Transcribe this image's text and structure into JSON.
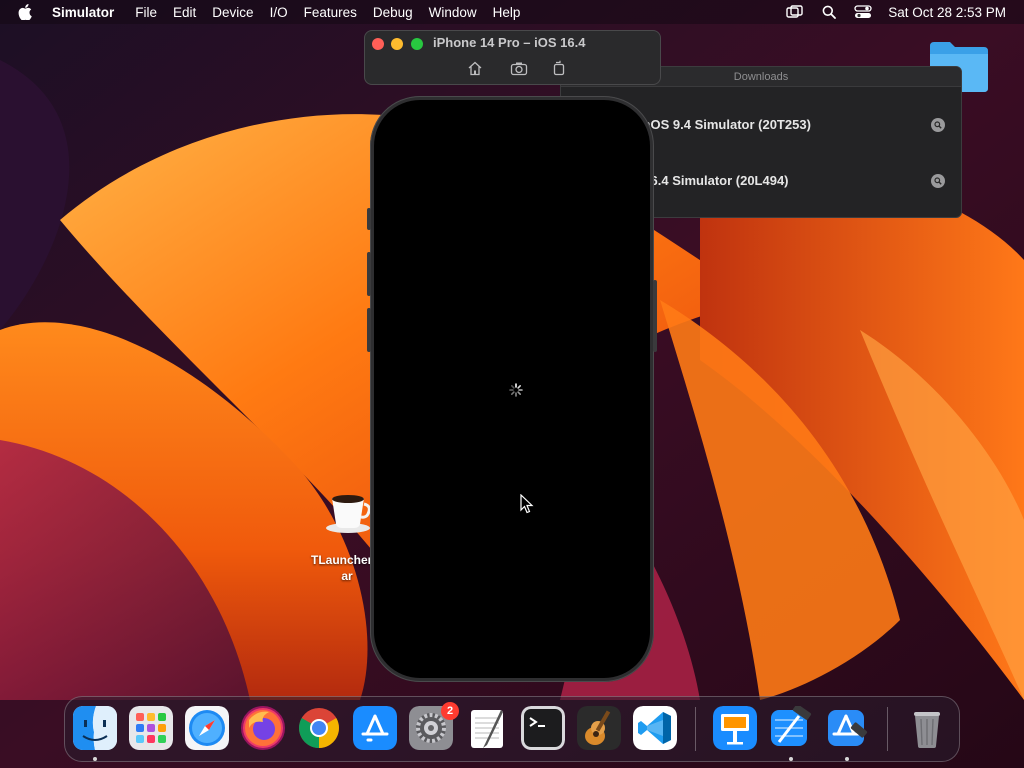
{
  "menubar": {
    "app_name": "Simulator",
    "items": [
      "File",
      "Edit",
      "Device",
      "I/O",
      "Features",
      "Debug",
      "Window",
      "Help"
    ],
    "clock": "Sat Oct 28  2:53 PM",
    "status_icons": [
      "screen-mirroring-icon",
      "search-icon",
      "control-center-icon"
    ]
  },
  "simulator_window": {
    "title": "iPhone 14 Pro – iOS 16.4",
    "toolbar_buttons": [
      "home-icon",
      "screenshot-icon",
      "rotate-icon"
    ]
  },
  "downloads_window": {
    "title": "Downloads",
    "items": [
      {
        "name": "watchOS 9.4 Simulator (20T253)",
        "visible_text": "tchOS 9.4 Simulator (20T253)"
      },
      {
        "name": "iOS 16.4 Simulator (20L494)",
        "visible_text": "S 16.4 Simulator (20L494)"
      }
    ]
  },
  "desktop": {
    "tlauncher_label_line1": "TLauncher-2",
    "tlauncher_label_line2": "ar"
  },
  "dock": {
    "apps": [
      {
        "name": "Finder",
        "icon": "finder-icon",
        "running": true
      },
      {
        "name": "Launchpad",
        "icon": "launchpad-icon",
        "running": false
      },
      {
        "name": "Safari",
        "icon": "safari-icon",
        "running": false
      },
      {
        "name": "Firefox",
        "icon": "firefox-icon",
        "running": false
      },
      {
        "name": "Google Chrome",
        "icon": "chrome-icon",
        "running": false
      },
      {
        "name": "App Store",
        "icon": "app-store-icon",
        "running": false
      },
      {
        "name": "System Settings",
        "icon": "system-settings-icon",
        "running": false,
        "badge": "2"
      },
      {
        "name": "TextEdit",
        "icon": "textedit-icon",
        "running": false
      },
      {
        "name": "Terminal",
        "icon": "terminal-icon",
        "running": false
      },
      {
        "name": "GarageBand",
        "icon": "garageband-icon",
        "running": false
      },
      {
        "name": "Visual Studio Code",
        "icon": "vscode-icon",
        "running": false
      },
      {
        "name": "Keynote",
        "icon": "keynote-icon",
        "running": false
      },
      {
        "name": "Xcode",
        "icon": "xcode-icon",
        "running": true
      },
      {
        "name": "Simulator",
        "icon": "simulator-icon",
        "running": true
      },
      {
        "name": "Trash",
        "icon": "trash-icon",
        "running": false
      }
    ]
  },
  "colors": {
    "wallpaper_orange": "#ff6a00",
    "wallpaper_deep": "#3a0b2a",
    "accent_red_badge": "#ff3b30"
  }
}
